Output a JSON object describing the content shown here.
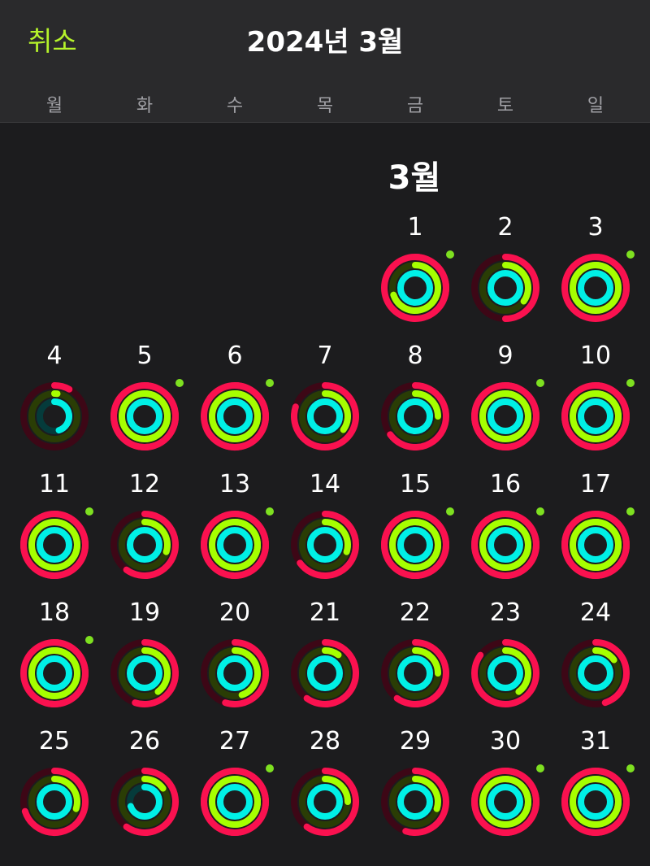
{
  "header": {
    "cancel_label": "취소",
    "title": "2024년 3월",
    "weekdays": [
      "월",
      "화",
      "수",
      "목",
      "금",
      "토",
      "일"
    ]
  },
  "month_label": "3월",
  "colors": {
    "accent": "#b5f22b",
    "move": "#fa114f",
    "move_track": "#3d0716",
    "exercise": "#a6ff00",
    "exercise_track": "#2a3d05",
    "stand": "#00f0e6",
    "stand_track": "#053b3b",
    "goal_dot": "#7ee020"
  },
  "first_weekday_index": 4,
  "days": [
    {
      "day": "1",
      "move": 1.35,
      "exercise": 0.7,
      "stand": 1.0,
      "closed": true
    },
    {
      "day": "2",
      "move": 0.5,
      "exercise": 0.35,
      "stand": 1.0,
      "closed": false
    },
    {
      "day": "3",
      "move": 1.3,
      "exercise": 1.1,
      "stand": 1.0,
      "closed": true
    },
    {
      "day": "4",
      "move": 0.08,
      "exercise": 0.02,
      "stand": 0.45,
      "closed": false
    },
    {
      "day": "5",
      "move": 1.9,
      "exercise": 1.5,
      "stand": 1.0,
      "closed": true
    },
    {
      "day": "6",
      "move": 1.7,
      "exercise": 1.3,
      "stand": 1.0,
      "closed": true
    },
    {
      "day": "7",
      "move": 0.8,
      "exercise": 0.35,
      "stand": 1.0,
      "closed": false
    },
    {
      "day": "8",
      "move": 0.65,
      "exercise": 0.25,
      "stand": 1.0,
      "closed": false
    },
    {
      "day": "9",
      "move": 1.9,
      "exercise": 1.45,
      "stand": 1.0,
      "closed": true
    },
    {
      "day": "10",
      "move": 1.85,
      "exercise": 1.4,
      "stand": 1.0,
      "closed": true
    },
    {
      "day": "11",
      "move": 1.8,
      "exercise": 1.4,
      "stand": 1.0,
      "closed": true
    },
    {
      "day": "12",
      "move": 0.6,
      "exercise": 0.3,
      "stand": 1.0,
      "closed": false
    },
    {
      "day": "13",
      "move": 1.85,
      "exercise": 1.45,
      "stand": 1.0,
      "closed": true
    },
    {
      "day": "14",
      "move": 0.65,
      "exercise": 0.3,
      "stand": 1.0,
      "closed": false
    },
    {
      "day": "15",
      "move": 1.9,
      "exercise": 1.45,
      "stand": 1.0,
      "closed": true
    },
    {
      "day": "16",
      "move": 1.9,
      "exercise": 1.45,
      "stand": 1.0,
      "closed": true
    },
    {
      "day": "17",
      "move": 1.85,
      "exercise": 1.5,
      "stand": 1.0,
      "closed": true
    },
    {
      "day": "18",
      "move": 1.55,
      "exercise": 1.2,
      "stand": 1.0,
      "closed": true
    },
    {
      "day": "19",
      "move": 0.55,
      "exercise": 0.4,
      "stand": 1.0,
      "closed": false
    },
    {
      "day": "20",
      "move": 0.55,
      "exercise": 0.45,
      "stand": 1.0,
      "closed": false
    },
    {
      "day": "21",
      "move": 0.6,
      "exercise": 0.1,
      "stand": 1.0,
      "closed": false
    },
    {
      "day": "22",
      "move": 0.6,
      "exercise": 0.25,
      "stand": 1.0,
      "closed": false
    },
    {
      "day": "23",
      "move": 0.85,
      "exercise": 0.4,
      "stand": 1.0,
      "closed": false
    },
    {
      "day": "24",
      "move": 0.45,
      "exercise": 0.15,
      "stand": 1.0,
      "closed": false
    },
    {
      "day": "25",
      "move": 0.7,
      "exercise": 0.3,
      "stand": 1.0,
      "closed": false
    },
    {
      "day": "26",
      "move": 0.6,
      "exercise": 0.15,
      "stand": 0.7,
      "closed": false
    },
    {
      "day": "27",
      "move": 1.95,
      "exercise": 1.5,
      "stand": 1.0,
      "closed": true
    },
    {
      "day": "28",
      "move": 0.6,
      "exercise": 0.25,
      "stand": 1.0,
      "closed": false
    },
    {
      "day": "29",
      "move": 0.55,
      "exercise": 0.3,
      "stand": 1.0,
      "closed": false
    },
    {
      "day": "30",
      "move": 1.9,
      "exercise": 1.45,
      "stand": 1.0,
      "closed": true
    },
    {
      "day": "31",
      "move": 1.85,
      "exercise": 1.4,
      "stand": 1.0,
      "closed": true
    }
  ]
}
